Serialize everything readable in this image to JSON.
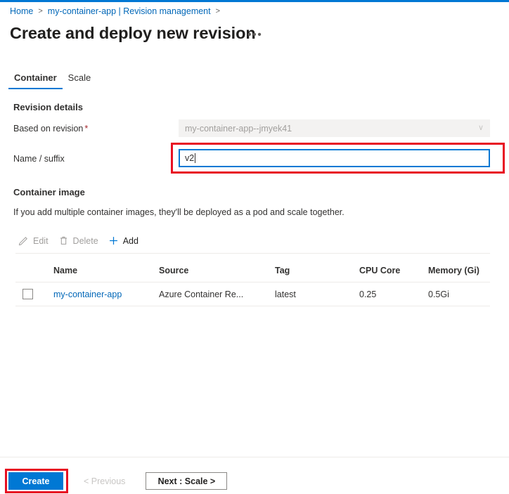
{
  "theme": {
    "accent": "#0078d4",
    "link": "#0067b8",
    "annotation": "#e81123",
    "required": "#a4262c",
    "disabled_text": "#a19f9d"
  },
  "breadcrumb": {
    "items": [
      {
        "label": "Home",
        "sep": ">"
      },
      {
        "label": "my-container-app | Revision management",
        "sep": ">"
      }
    ]
  },
  "header": {
    "title": "Create and deploy new revision",
    "more_menu": "•••"
  },
  "tabs": [
    {
      "label": "Container",
      "active": true
    },
    {
      "label": "Scale",
      "active": false
    }
  ],
  "revision_details": {
    "heading": "Revision details",
    "based_on_revision": {
      "label": "Based on revision",
      "required_marker": "*",
      "value": "my-container-app--jmyek41",
      "chevron": "∨",
      "disabled": true
    },
    "name_suffix": {
      "label": "Name / suffix",
      "value": "v2",
      "focused": true
    }
  },
  "container_image": {
    "heading": "Container image",
    "description": "If you add multiple container images, they'll be deployed as a pod and scale together.",
    "commands": [
      {
        "label": "Edit",
        "icon": "pencil-icon",
        "enabled": false
      },
      {
        "label": "Delete",
        "icon": "trash-icon",
        "enabled": false
      },
      {
        "label": "Add",
        "icon": "plus-icon",
        "enabled": true
      }
    ],
    "table": {
      "columns": [
        "Name",
        "Source",
        "Tag",
        "CPU Core",
        "Memory (Gi)"
      ],
      "rows": [
        {
          "selected": false,
          "name": "my-container-app",
          "source": "Azure Container Re...",
          "tag": "latest",
          "cpu_core": "0.25",
          "memory": "0.5Gi"
        }
      ]
    }
  },
  "footer": {
    "create_label": "Create",
    "previous_label": "< Previous",
    "next_label": "Next : Scale >"
  }
}
